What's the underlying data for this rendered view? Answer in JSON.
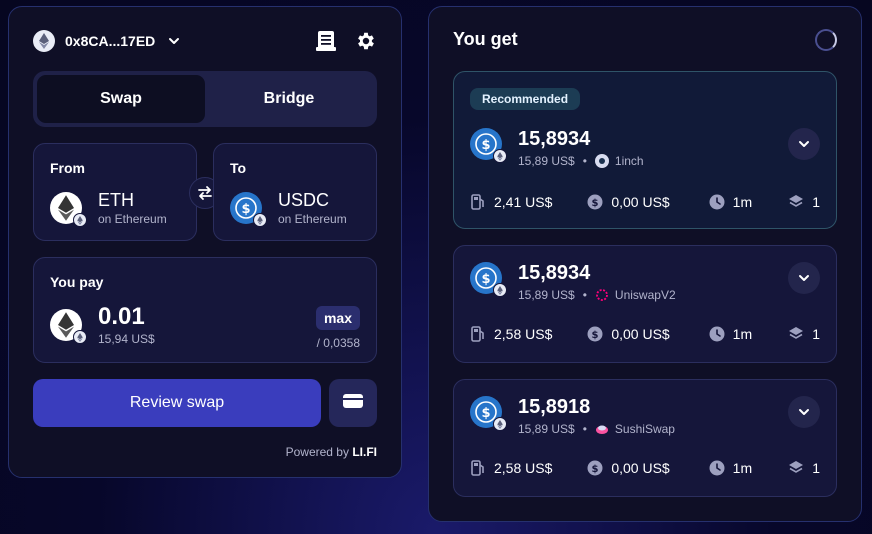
{
  "wallet": {
    "address": "0x8CA...17ED"
  },
  "tabs": [
    {
      "label": "Swap",
      "active": true
    },
    {
      "label": "Bridge",
      "active": false
    }
  ],
  "from": {
    "label": "From",
    "token": "ETH",
    "chain": "on Ethereum"
  },
  "to": {
    "label": "To",
    "token": "USDC",
    "chain": "on Ethereum"
  },
  "pay": {
    "label": "You pay",
    "amount": "0.01",
    "usd": "15,94 US$",
    "max_label": "max",
    "balance": "/ 0,0358"
  },
  "actions": {
    "review_label": "Review swap"
  },
  "powered": {
    "prefix": "Powered by",
    "brand": "LI.FI"
  },
  "results": {
    "title": "You get",
    "recommended_label": "Recommended",
    "routes": [
      {
        "amount": "15,8934",
        "usd": "15,89 US$",
        "provider": "1inch",
        "gas": "2,41 US$",
        "fees": "0,00 US$",
        "time": "1m",
        "steps": "1"
      },
      {
        "amount": "15,8934",
        "usd": "15,89 US$",
        "provider": "UniswapV2",
        "gas": "2,58 US$",
        "fees": "0,00 US$",
        "time": "1m",
        "steps": "1"
      },
      {
        "amount": "15,8918",
        "usd": "15,89 US$",
        "provider": "SushiSwap",
        "gas": "2,58 US$",
        "fees": "0,00 US$",
        "time": "1m",
        "steps": "1"
      }
    ]
  },
  "colors": {
    "accent": "#3a3dbd",
    "usdc": "#2775ca",
    "panel_border": "#26306e",
    "recommended_bg": "#1c3c54"
  },
  "icons": [
    "ethereum-icon",
    "chevron-down-icon",
    "receipt-icon",
    "gear-icon",
    "swap-arrows-icon",
    "usdc-icon",
    "wallet-icon",
    "spinner-icon",
    "gas-pump-icon",
    "dollar-coin-icon",
    "clock-icon",
    "layers-icon"
  ]
}
